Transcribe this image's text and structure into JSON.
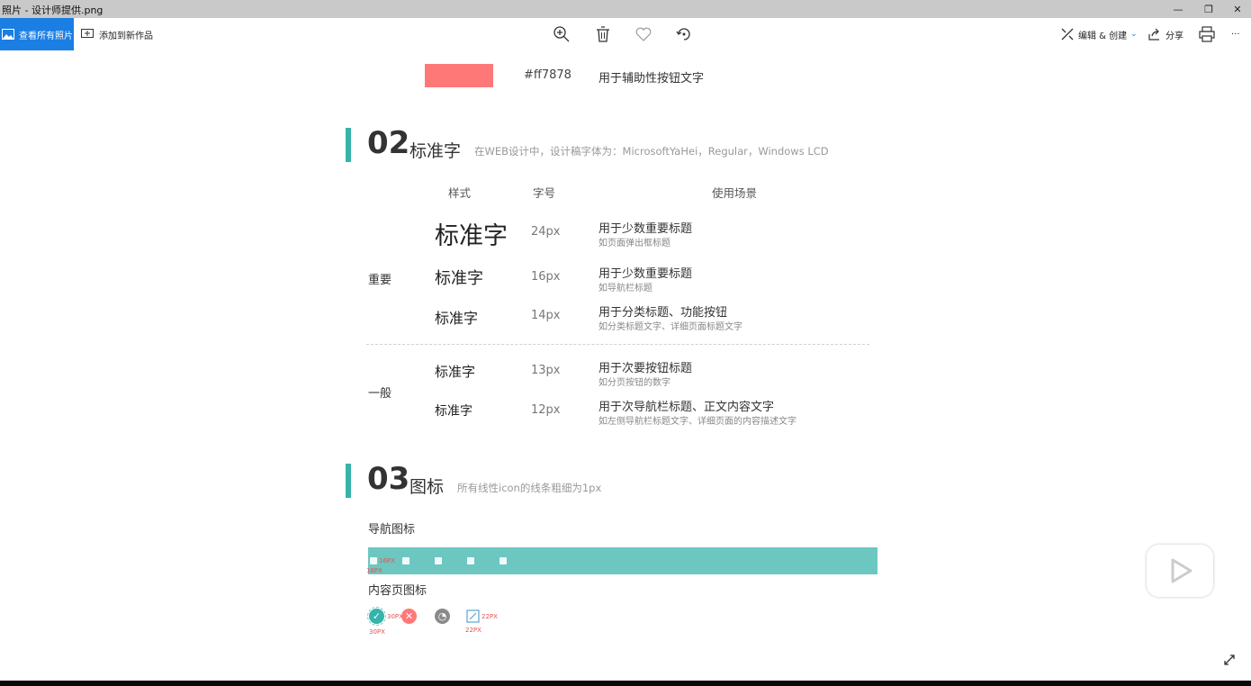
{
  "window": {
    "title": "照片 - 设计师提供.png",
    "minimize": "—",
    "restore": "❐",
    "close": "✕"
  },
  "toolbar": {
    "view_all": "查看所有照片",
    "add_to_creation": "添加到新作品",
    "edit_create": "编辑 & 创建",
    "share": "分享",
    "more": "···"
  },
  "color_row": {
    "hex": "#ff7878",
    "desc": "用于辅助性按钮文字",
    "color": "#ff7878"
  },
  "section2": {
    "num": "02",
    "title": "标准字",
    "note": "在WEB设计中，设计稿字体为：MicrosoftYaHei，Regular，Windows LCD",
    "headers": {
      "style": "样式",
      "size": "字号",
      "usage": "使用场景"
    },
    "group_important": "重要",
    "group_normal": "一般",
    "rows": [
      {
        "sample": "标准字",
        "size": "24px",
        "usage": "用于少数重要标题",
        "sub": "如页面弹出框标题"
      },
      {
        "sample": "标准字",
        "size": "16px",
        "usage": "用于少数重要标题",
        "sub": "如导航栏标题"
      },
      {
        "sample": "标准字",
        "size": "14px",
        "usage": "用于分类标题、功能按钮",
        "sub": "如分类标题文字、详细页面标题文字"
      },
      {
        "sample": "标准字",
        "size": "13px",
        "usage": "用于次要按钮标题",
        "sub": "如分页按钮的数字"
      },
      {
        "sample": "标准字",
        "size": "12px",
        "usage": "用于次导航栏标题、正文内容文字",
        "sub": "如左侧导航栏标题文字、详细页面的内容描述文字"
      }
    ]
  },
  "section3": {
    "num": "03",
    "title": "图标",
    "note": "所有线性icon的线条粗细为1px",
    "nav_icons": "导航图标",
    "content_icons": "内容页图标",
    "nav_dim_a": "16PX",
    "nav_dim_b": "16PX",
    "dim_30_a": "30PX",
    "dim_30_b": "30PX",
    "dim_22_a": "22PX",
    "dim_22_b": "22PX",
    "bar_color": "#6cc7c1",
    "accent": "#36b3aa"
  },
  "icons": [
    "photo-icon",
    "add-icon",
    "zoom-in-icon",
    "delete-icon",
    "favorite-icon",
    "rotate-icon",
    "edit-create-icon",
    "share-icon",
    "print-icon",
    "play-icon",
    "fullscreen-icon"
  ]
}
